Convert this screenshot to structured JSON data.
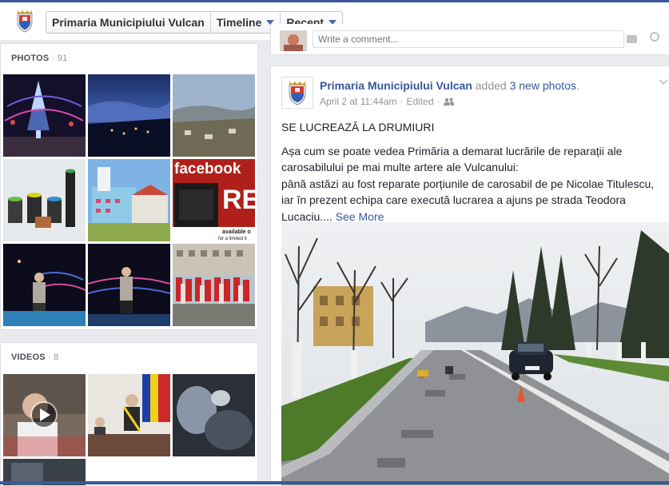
{
  "header": {
    "page_name": "Primaria Municipiului Vulcan",
    "tabs": [
      {
        "label": "Timeline"
      },
      {
        "label": "Recent"
      }
    ]
  },
  "photos": {
    "title": "PHOTOS",
    "count": "· 91"
  },
  "videos": {
    "title": "VIDEOS",
    "count": "· 8"
  },
  "composer": {
    "placeholder": "Write a comment..."
  },
  "post": {
    "author": "Primaria Municipiului Vulcan",
    "action_prefix": "added",
    "action_link": "3 new photos",
    "action_suffix": ".",
    "date": "April 2 at 11:44am",
    "separator": "·",
    "edited": "Edited",
    "headline": "SE LUCREAZĂ LA DRUMIURI",
    "lines": [
      "Așa cum se poate vedea Primăria a demarat lucrările de reparații ale carosabilului pe mai multe artere ale Vulcanului:",
      "până astăzi au fost reparate porțiunile de carosabil de pe Nicolae Titulescu, iar în prezent echipa care execută lucrarea a ajuns pe strada Teodora Lucaciu...."
    ],
    "see_more": "See More"
  },
  "thumb_text": {
    "facebook": "facebook",
    "available": "available o",
    "limited": "for a limited ti"
  },
  "colors": {
    "brand": "#3b5998",
    "link": "#365899",
    "background": "#e9ebee"
  }
}
